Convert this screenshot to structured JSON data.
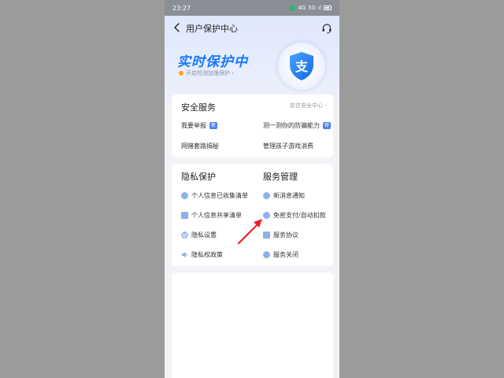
{
  "status_bar": {
    "time": "23:27",
    "network": "4G",
    "speed": "5G",
    "signal": "ıl"
  },
  "header": {
    "title": "用户保护中心"
  },
  "hero": {
    "title": "实时保护中",
    "subtitle": "开启检测加强保护 ›",
    "shield_glyph": "支"
  },
  "security_services": {
    "title": "安全服务",
    "link": "前往安全中心 ›",
    "items": [
      {
        "label": "我要举报",
        "badge": "新"
      },
      {
        "label": "测一测你的防骗能力",
        "badge": "荐"
      },
      {
        "label": "网赌套路揭秘"
      },
      {
        "label": "管理孩子游戏消费"
      }
    ]
  },
  "privacy": {
    "title": "隐私保护",
    "items": [
      {
        "label": "个人信息已收集清单",
        "icon": "list-icon"
      },
      {
        "label": "个人信息共享清单",
        "icon": "folder-icon"
      },
      {
        "label": "隐私设置",
        "icon": "gear-icon"
      },
      {
        "label": "隐私权政策",
        "icon": "speaker-icon"
      }
    ]
  },
  "service_mgmt": {
    "title": "服务管理",
    "items": [
      {
        "label": "新消息通知",
        "icon": "message-icon"
      },
      {
        "label": "免密支付/自动扣款",
        "icon": "payment-icon"
      },
      {
        "label": "服务协议",
        "icon": "document-icon"
      },
      {
        "label": "服务关闭",
        "icon": "close-service-icon"
      }
    ]
  },
  "colors": {
    "accent": "#1677ff",
    "arrow": "#e8212b",
    "badge": "#4d82e8"
  }
}
